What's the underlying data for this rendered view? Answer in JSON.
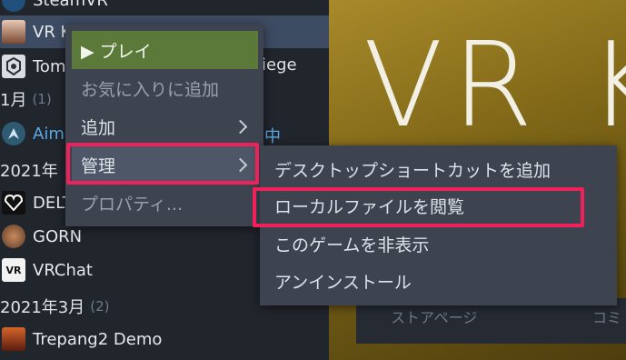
{
  "library": {
    "rows": [
      {
        "title": "SteamVR",
        "icon": "steamvr-icon",
        "icon_text": ""
      },
      {
        "title": "VR K",
        "icon": "vr-kanojo-icon",
        "icon_text": ""
      },
      {
        "title": "Tom",
        "suffix": "iege",
        "icon": "rainbow-six-siege-icon",
        "icon_text": ""
      },
      {
        "title": "Aim",
        "suffix": "中",
        "icon": "aim-icon",
        "icon_text": ""
      },
      {
        "title": "DELT",
        "icon": "deltarune-icon",
        "icon_text": ""
      },
      {
        "title": "GORN",
        "icon": "gorn-icon",
        "icon_text": ""
      },
      {
        "title": "VRChat",
        "icon": "vrchat-icon",
        "icon_text": "VR"
      },
      {
        "title": "Trepang2 Demo",
        "icon": "trepang2-icon",
        "icon_text": ""
      }
    ],
    "sections": [
      {
        "label": "1月",
        "count": "(1)"
      },
      {
        "label": "2021年",
        "count": ""
      },
      {
        "label": "2021年3月",
        "count": "(2)"
      }
    ]
  },
  "hero": {
    "title": "VR K",
    "bottom_links": [
      "ストアページ",
      "コミ"
    ]
  },
  "context_menu": {
    "items": [
      {
        "label": "▶ プレイ"
      },
      {
        "label": "お気に入りに追加"
      },
      {
        "label": "追加"
      },
      {
        "label": "管理"
      },
      {
        "label": "プロパティ..."
      }
    ]
  },
  "submenu": {
    "items": [
      {
        "label": "デスクトップショートカットを追加"
      },
      {
        "label": "ローカルファイルを閲覧"
      },
      {
        "label": "このゲームを非表示"
      },
      {
        "label": "アンインストール"
      }
    ]
  },
  "colors": {
    "play_green": "#5b7a3a",
    "highlight": "#f0205a",
    "hover": "#4d5767",
    "selected_row": "#3d4b63"
  }
}
